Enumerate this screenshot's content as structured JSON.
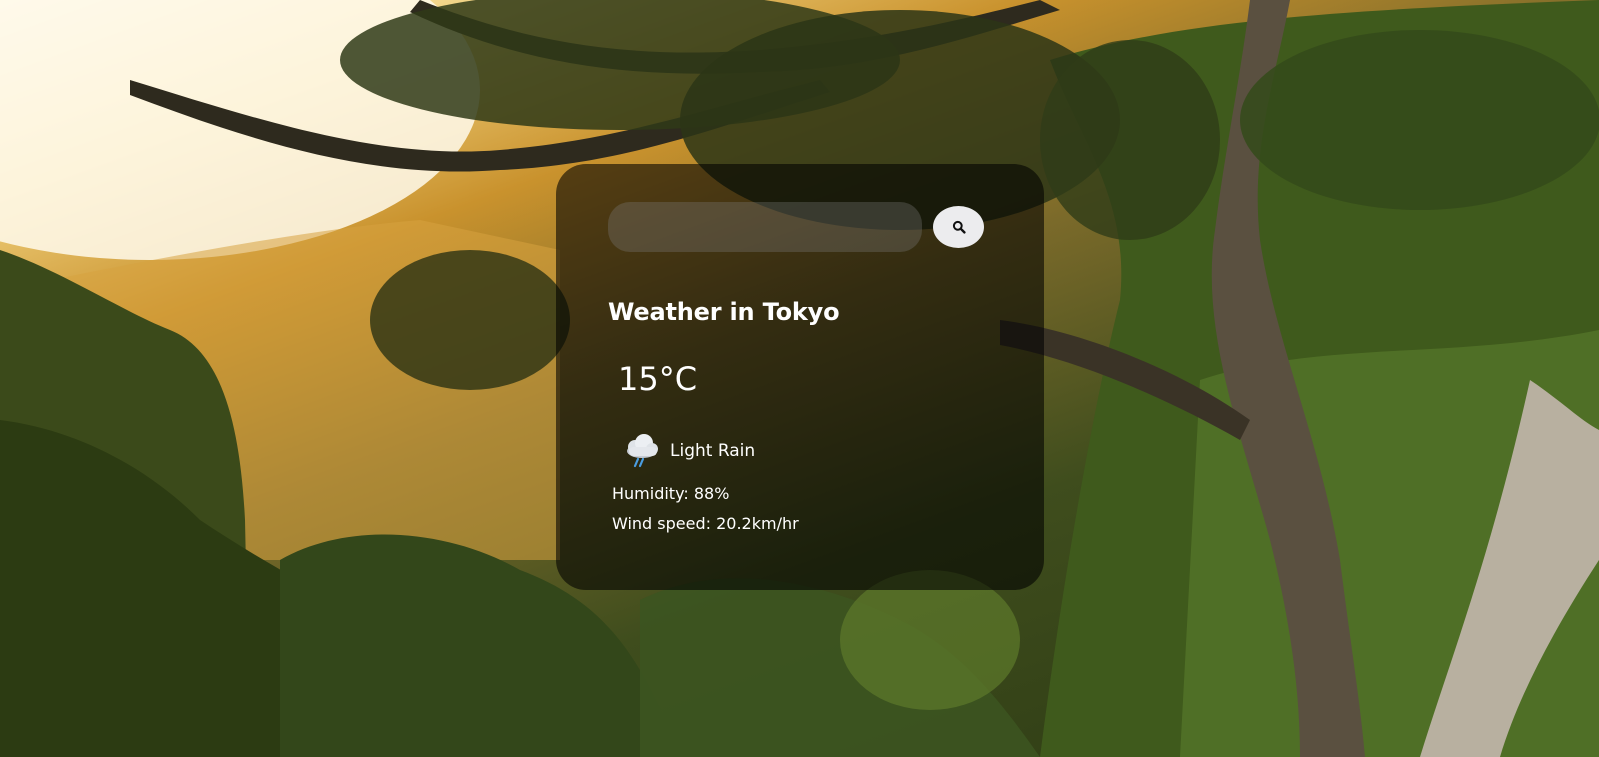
{
  "search": {
    "value": "",
    "placeholder": "",
    "button_icon": "search-icon"
  },
  "weather": {
    "city_label": "Weather in Tokyo",
    "temperature": "15°C",
    "icon": "light-rain-cloud-icon",
    "description": "Light Rain",
    "humidity": "Humidity: 88%",
    "wind": "Wind speed: 20.2km/hr"
  },
  "colors": {
    "card_background": "rgba(0,0,0,0.58)",
    "search_field": "#7c7c7c",
    "search_button": "#ececee",
    "text": "#ffffff",
    "rain_accent": "#4a9de0"
  }
}
